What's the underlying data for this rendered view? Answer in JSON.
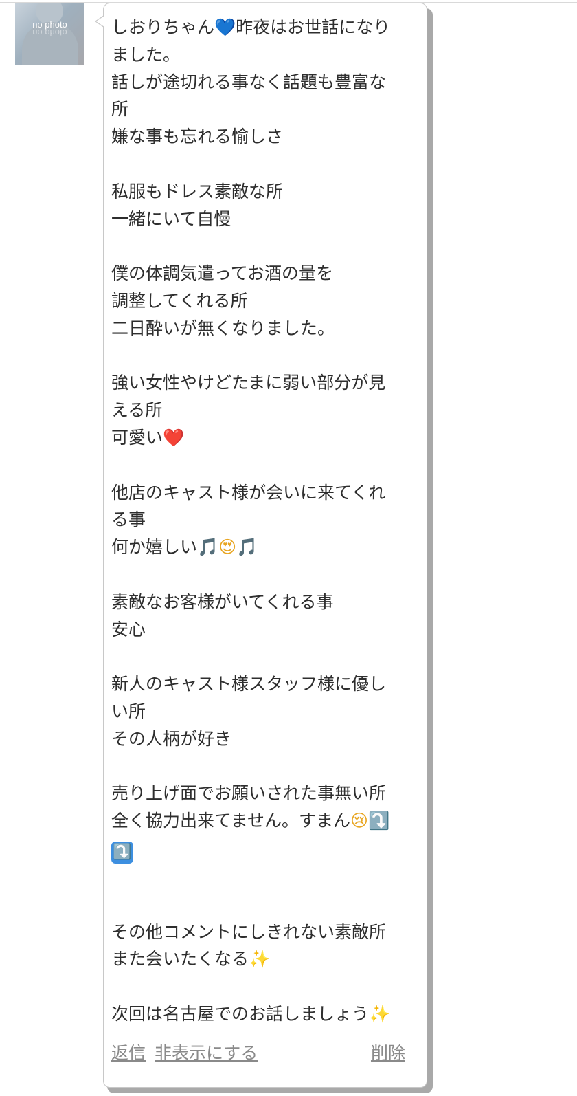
{
  "avatar": {
    "text": "no photo"
  },
  "message": {
    "lines": [
      {
        "text": "しおりちゃん",
        "emoji": "💙",
        "emoji_after": "昨夜はお世話になり"
      },
      {
        "text": "ました。"
      },
      {
        "text": "話しが途切れる事なく話題も豊富な"
      },
      {
        "text": "所"
      },
      {
        "text": "嫌な事も忘れる愉しさ"
      },
      {
        "text": ""
      },
      {
        "text": "私服もドレス素敵な所"
      },
      {
        "text": "一緒にいて自慢"
      },
      {
        "text": ""
      },
      {
        "text": "僕の体調気遣ってお酒の量を"
      },
      {
        "text": "調整してくれる所"
      },
      {
        "text": "二日酔いが無くなりました。"
      },
      {
        "text": ""
      },
      {
        "text": "強い女性やけどたまに弱い部分が見"
      },
      {
        "text": "える所"
      },
      {
        "text": "可愛い",
        "emoji": "❤️"
      },
      {
        "text": ""
      },
      {
        "text": "他店のキャスト様が会いに来てくれ"
      },
      {
        "text": "る事"
      },
      {
        "text": "何か嬉しい",
        "emoji": "🎵😍🎵"
      },
      {
        "text": ""
      },
      {
        "text": "素敵なお客様がいてくれる事"
      },
      {
        "text": "安心"
      },
      {
        "text": ""
      },
      {
        "text": "新人のキャスト様スタッフ様に優し"
      },
      {
        "text": "い所"
      },
      {
        "text": "その人柄が好き"
      },
      {
        "text": ""
      },
      {
        "text": "売り上げ面でお願いされた事無い所"
      },
      {
        "text": "全く協力出来てません。すまん",
        "emoji": "😢⤵️"
      },
      {
        "text": "",
        "emoji": "⤵️"
      },
      {
        "text": ""
      },
      {
        "text": ""
      },
      {
        "text": "その他コメントにしきれない素敵所"
      },
      {
        "text": "また会いたくなる",
        "emoji": "✨"
      },
      {
        "text": ""
      },
      {
        "text": "次回は名古屋でのお話しましょう",
        "emoji": "✨"
      }
    ]
  },
  "actions": {
    "reply": "返信",
    "hide": "非表示にする",
    "delete": "削除"
  }
}
